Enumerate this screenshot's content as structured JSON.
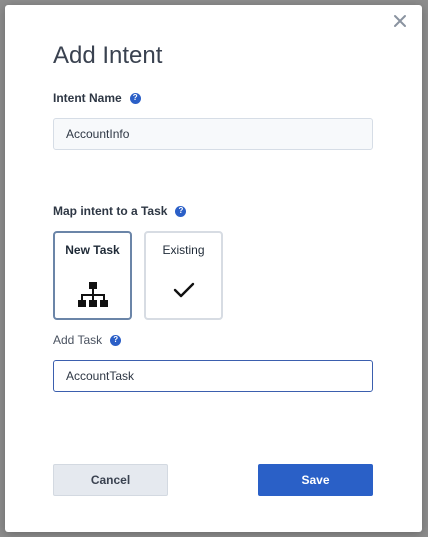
{
  "modal": {
    "title": "Add Intent",
    "intent_name": {
      "label": "Intent Name",
      "value": "AccountInfo"
    },
    "map_task": {
      "label": "Map intent to a Task",
      "options": [
        {
          "label": "New Task",
          "icon": "hierarchy-icon",
          "selected": true
        },
        {
          "label": "Existing",
          "icon": "checkmark-icon",
          "selected": false
        }
      ]
    },
    "add_task": {
      "label": "Add Task",
      "value": "AccountTask"
    },
    "buttons": {
      "cancel": "Cancel",
      "save": "Save"
    }
  },
  "colors": {
    "primary": "#2a60c7",
    "help_icon": "#2b5fc7",
    "selected_border": "#6b85a8",
    "backdrop": "#8d8d8d"
  }
}
